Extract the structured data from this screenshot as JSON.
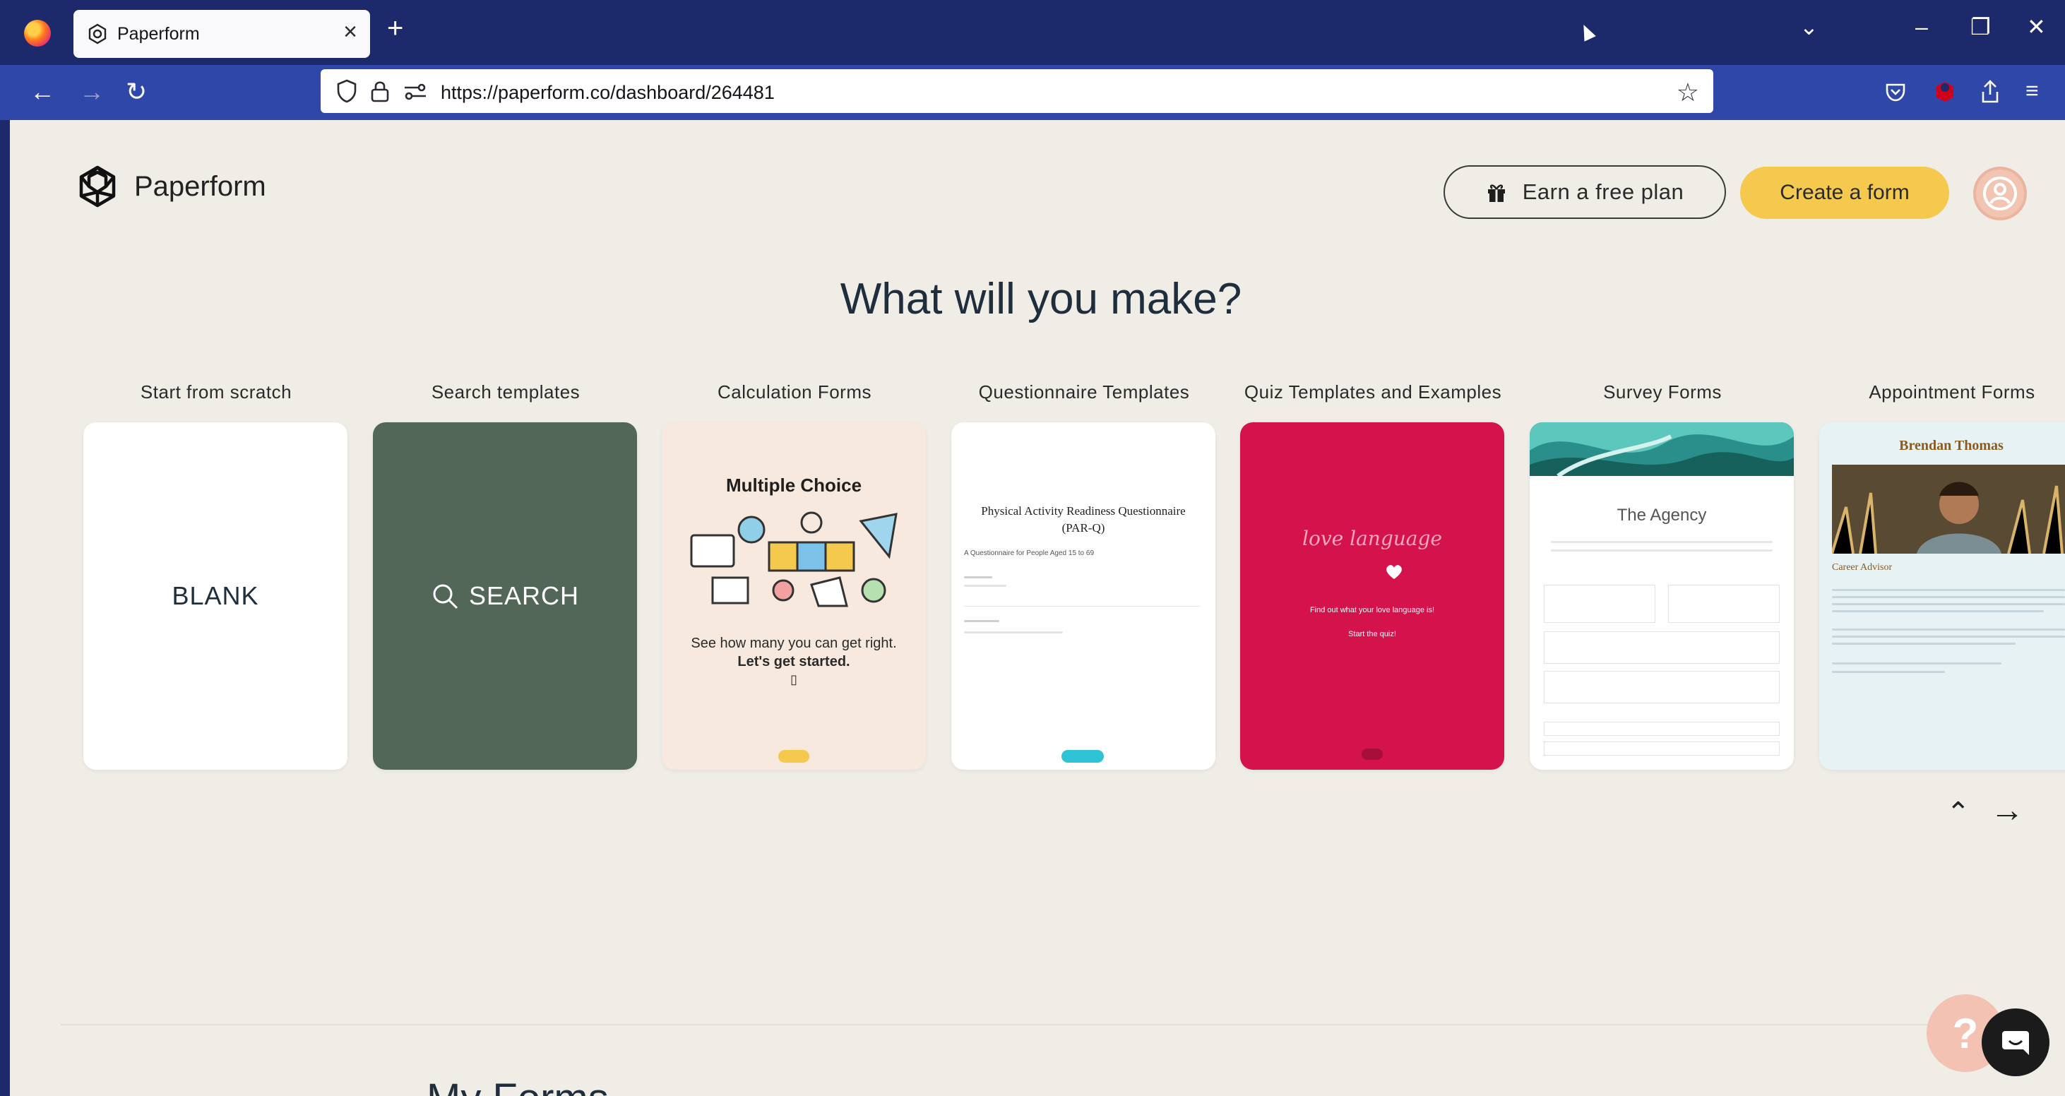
{
  "browser": {
    "tab_title": "Paperform",
    "url_prefix": "https://",
    "url_domain": "paperform.co",
    "url_path": "/dashboard/264481"
  },
  "header": {
    "brand": "Paperform",
    "earn_label": "Earn a free plan",
    "create_label": "Create a form"
  },
  "main": {
    "headline": "What will you make?",
    "categories": [
      "Start from scratch",
      "Search templates",
      "Calculation Forms",
      "Questionnaire Templates",
      "Quiz Templates and Examples",
      "Survey Forms",
      "Appointment Forms"
    ],
    "blank_label": "BLANK",
    "search_label": "SEARCH",
    "calc_card": {
      "title": "Multiple Choice",
      "line1": "See how many you can get right.",
      "line2": "Let's get started.",
      "cursor": "▯"
    },
    "quest_card": {
      "title": "Physical Activity Readiness Questionnaire (PAR-Q)",
      "subtitle": "A Questionnaire for People Aged 15 to 69"
    },
    "quiz_card": {
      "script": "love language",
      "line1": "Find out what your love language is!",
      "line2": "Start the quiz!"
    },
    "survey_card": {
      "title": "The Agency"
    },
    "appt_card": {
      "name": "Brendan Thomas",
      "role": "Career Advisor"
    },
    "next_section": "My Forms"
  },
  "colors": {
    "chrome": "#1c2a6b",
    "navbar": "#2f47a8",
    "page_bg": "#efede6",
    "accent_yellow": "#f5c94e",
    "search_card": "#536759",
    "quiz_card": "#d4124b"
  }
}
